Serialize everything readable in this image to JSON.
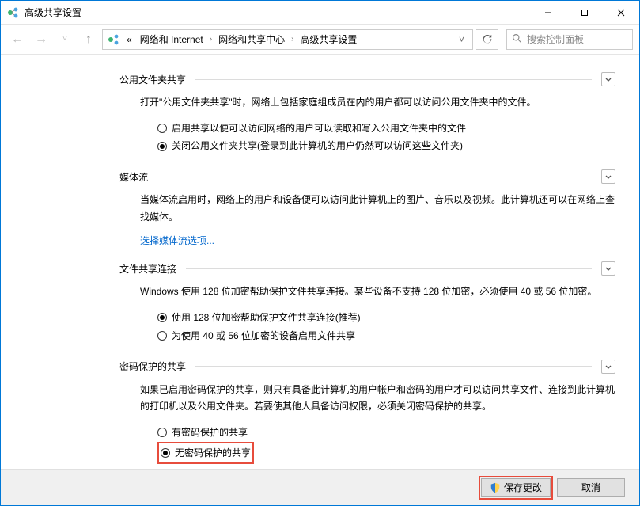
{
  "window": {
    "title": "高级共享设置"
  },
  "breadcrumb": {
    "prefix": "«",
    "items": [
      "网络和 Internet",
      "网络和共享中心",
      "高级共享设置"
    ]
  },
  "search": {
    "placeholder": "搜索控制面板"
  },
  "sections": {
    "publicFolder": {
      "title": "公用文件夹共享",
      "desc": "打开\"公用文件夹共享\"时，网络上包括家庭组成员在内的用户都可以访问公用文件夹中的文件。",
      "opt1": "启用共享以便可以访问网络的用户可以读取和写入公用文件夹中的文件",
      "opt2": "关闭公用文件夹共享(登录到此计算机的用户仍然可以访问这些文件夹)"
    },
    "media": {
      "title": "媒体流",
      "desc": "当媒体流启用时，网络上的用户和设备便可以访问此计算机上的图片、音乐以及视频。此计算机还可以在网络上查找媒体。",
      "link": "选择媒体流选项..."
    },
    "fileConn": {
      "title": "文件共享连接",
      "desc": "Windows 使用 128 位加密帮助保护文件共享连接。某些设备不支持 128 位加密，必须使用 40 或 56 位加密。",
      "opt1": "使用 128 位加密帮助保护文件共享连接(推荐)",
      "opt2": "为使用 40 或 56 位加密的设备启用文件共享"
    },
    "password": {
      "title": "密码保护的共享",
      "desc": "如果已启用密码保护的共享，则只有具备此计算机的用户帐户和密码的用户才可以访问共享文件、连接到此计算机的打印机以及公用文件夹。若要使其他人具备访问权限，必须关闭密码保护的共享。",
      "opt1": "有密码保护的共享",
      "opt2": "无密码保护的共享"
    }
  },
  "footer": {
    "save": "保存更改",
    "cancel": "取消"
  }
}
